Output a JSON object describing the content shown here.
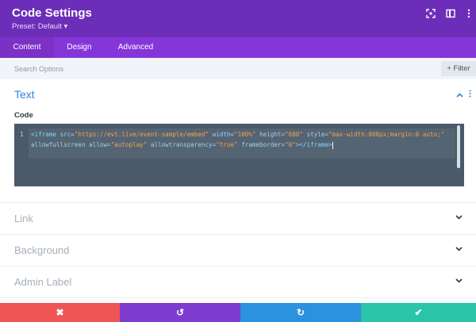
{
  "header": {
    "title": "Code Settings",
    "preset": "Preset: Default ▾",
    "icons": [
      "expand-icon",
      "sidebar-icon",
      "more-icon"
    ]
  },
  "tabs": [
    {
      "label": "Content",
      "active": true
    },
    {
      "label": "Design",
      "active": false
    },
    {
      "label": "Advanced",
      "active": false
    }
  ],
  "search": {
    "placeholder": "Search Options",
    "filter_label": "+ Filter"
  },
  "text_section": {
    "title": "Text",
    "code_label": "Code",
    "line_number": "1",
    "code": {
      "p1": "<iframe ",
      "p2": "src=",
      "p3": "\"https://evt.live/event-sample/embed\"",
      "p4": " width=",
      "p5": "\"100%\"",
      "p6": " height=",
      "p7": "\"600\"",
      "p8": " style=",
      "p9": "\"max-width:800px;margin:0 auto;\"",
      "p10": " allowfullscreen allow=",
      "p11": "\"autoplay\"",
      "p12": " allowtransparency=",
      "p13": "\"true\"",
      "p14": " frameborder=",
      "p15": "\"0\"",
      "p16": "></iframe>"
    }
  },
  "sections": [
    {
      "label": "Link"
    },
    {
      "label": "Background"
    },
    {
      "label": "Admin Label"
    }
  ],
  "footer": {
    "cancel": "✖",
    "undo": "↺",
    "redo": "↻",
    "save": "✔"
  },
  "colors": {
    "header": "#6c2eb9",
    "tabs": "#8536d9",
    "accent": "#2b87da",
    "cancel": "#ef5555",
    "undo": "#7d3bd0",
    "redo": "#2a92de",
    "save": "#29c4a9"
  }
}
